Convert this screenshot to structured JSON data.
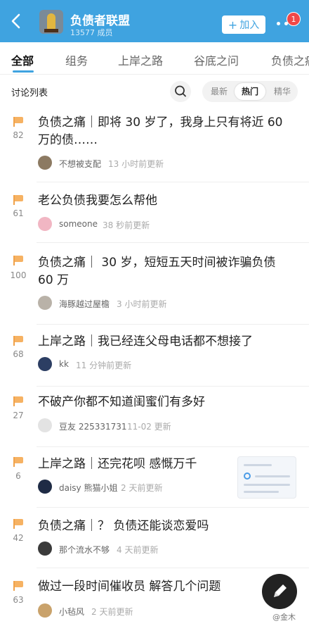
{
  "header": {
    "back_icon": "chevron-left-icon",
    "avatar_icon": "group-avatar-icon",
    "title": "负债者联盟",
    "members": "13577 成员",
    "join_label": "加入",
    "join_icon": "plus-icon",
    "more_icon": "more-dots-icon",
    "badge_count": "1",
    "bg_color": "#3fa3e0"
  },
  "tabs": [
    "全部",
    "组务",
    "上岸之路",
    "谷底之问",
    "负债之痛"
  ],
  "active_tab": 0,
  "list_header": {
    "title": "讨论列表",
    "search_icon": "search-icon",
    "sort_options": [
      "最新",
      "热门",
      "精华"
    ],
    "sort_selected": 1
  },
  "posts": [
    {
      "count": "82",
      "title_line1": "负债之痛｜即将 30 岁了，我身上只有将近 60",
      "title_line2": "万的债……",
      "author": "不想被支配",
      "time": "13 小时前更新"
    },
    {
      "count": "61",
      "title_line1": "老公负债我要怎么帮他",
      "title_line2": "",
      "author": "someone",
      "time": "38 秒前更新"
    },
    {
      "count": "100",
      "title_line1": "负债之痛｜ 30 岁，短短五天时间被诈骗负债",
      "title_line2": "60 万",
      "author": "海豚越过屋檐",
      "time": "3 小时前更新"
    },
    {
      "count": "68",
      "title_line1": "上岸之路｜我已经连父母电话都不想接了",
      "title_line2": "",
      "author": "kk",
      "time": "11 分钟前更新"
    },
    {
      "count": "27",
      "title_line1": "不破产你都不知道闺蜜们有多好",
      "title_line2": "",
      "author": "豆友 225331731",
      "time": "11-02 更新"
    },
    {
      "count": "6",
      "title_line1": "上岸之路｜还完花呗 感慨万千",
      "title_line2": "",
      "author": "daisy 熊猫小姐",
      "time": "2 天前更新"
    },
    {
      "count": "42",
      "title_line1": "负债之痛｜？ 负债还能谈恋爱吗",
      "title_line2": "",
      "author": "那个流水不够",
      "time": "4 天前更新"
    },
    {
      "count": "63",
      "title_line1": "做过一段时间催收员 解答几个问题",
      "title_line2": "",
      "author": "小毡风",
      "time": "2 天前更新"
    }
  ],
  "fab_icon": "pencil-icon",
  "watermark": "@金木"
}
